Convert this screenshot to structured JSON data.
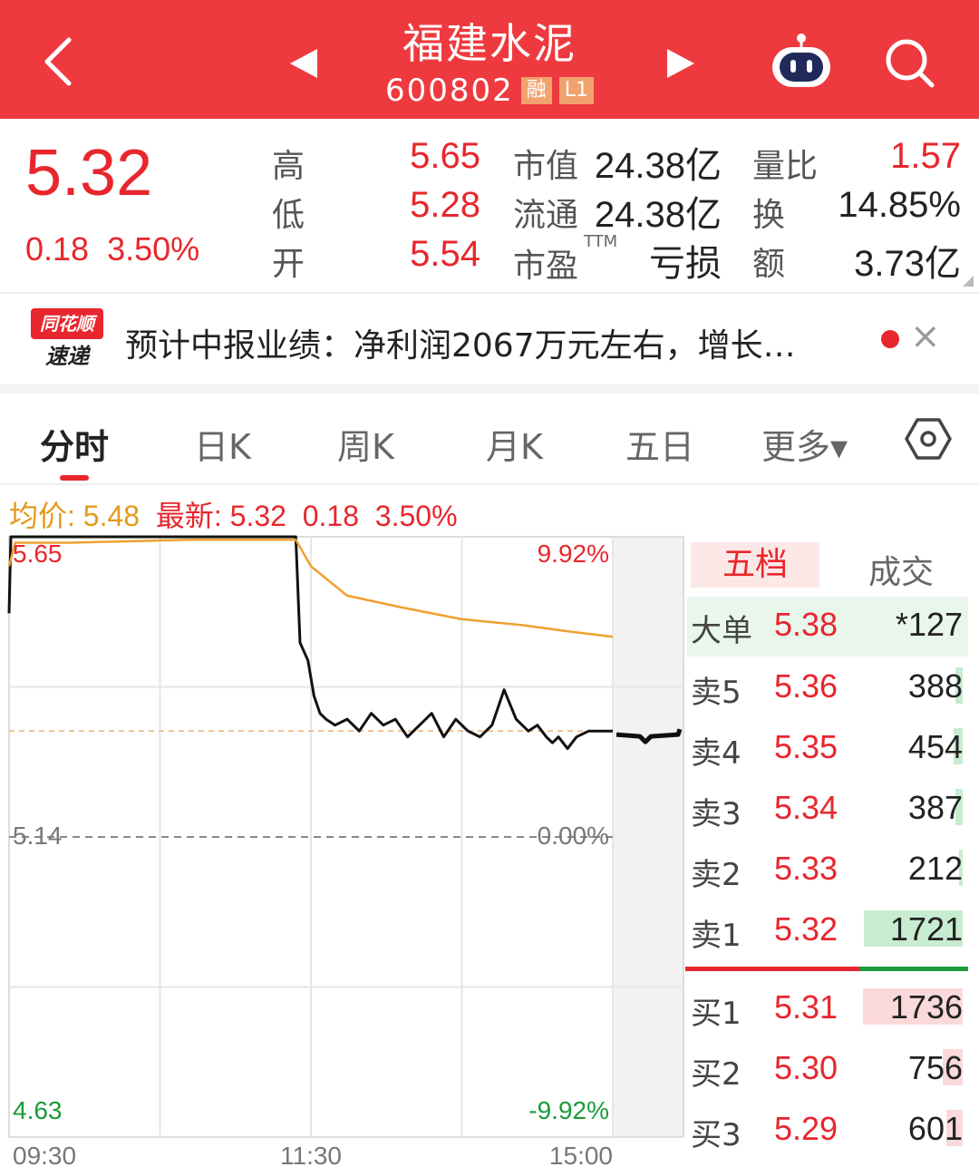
{
  "header": {
    "title": "福建水泥",
    "code": "600802",
    "tags": [
      "融",
      "L1"
    ],
    "icons": [
      "back-chevron-icon",
      "prev-stock-icon",
      "next-stock-icon",
      "robot-assistant-icon",
      "search-icon"
    ],
    "color": "#ee3a3f"
  },
  "quote": {
    "price": "5.32",
    "change": "0.18",
    "change_pct": "3.50%",
    "stats": [
      {
        "label": "高",
        "value": "5.65"
      },
      {
        "label": "低",
        "value": "5.28"
      },
      {
        "label": "开",
        "value": "5.54"
      },
      {
        "label": "市值",
        "value": "24.38亿"
      },
      {
        "label": "流通",
        "value": "24.38亿"
      },
      {
        "label": "市盈",
        "value": "亏损",
        "sup": "TTM"
      },
      {
        "label": "量比",
        "value": "1.57"
      },
      {
        "label": "换",
        "value": "14.85%"
      },
      {
        "label": "额",
        "value": "3.73亿"
      }
    ]
  },
  "news": {
    "logo_top": "同花顺",
    "logo_bottom": "速递",
    "text": "预计中报业绩：净利润2067万元左右，增长…",
    "close": "×"
  },
  "tabs": [
    "分时",
    "日K",
    "周K",
    "月K",
    "五日",
    "更多▾"
  ],
  "info": {
    "avg_label": "均价: 5.48",
    "latest_label": "最新: 5.32",
    "change": "0.18",
    "change_pct": "3.50%"
  },
  "chart_data": {
    "type": "line",
    "title": "",
    "x_ticks": [
      "09:30",
      "11:30",
      "15:00"
    ],
    "y_left_ticks": [
      "5.65",
      "5.14",
      "4.63"
    ],
    "y_right_ticks": [
      "9.92%",
      "0.00%",
      "-9.92%"
    ],
    "ylim": [
      4.63,
      5.65
    ],
    "prev_close": 5.14,
    "series": [
      {
        "name": "最新",
        "color": "#111111",
        "x": [
          0,
          0.003,
          0.01,
          0.2,
          0.4,
          0.475,
          0.482,
          0.495,
          0.505,
          0.515,
          0.525,
          0.54,
          0.56,
          0.58,
          0.6,
          0.62,
          0.64,
          0.66,
          0.68,
          0.7,
          0.72,
          0.74,
          0.76,
          0.78,
          0.8,
          0.82,
          0.84,
          0.86,
          0.875,
          0.89,
          0.9,
          0.91,
          0.925,
          0.94,
          0.96,
          0.98,
          1.0
        ],
        "y": [
          5.52,
          5.65,
          5.65,
          5.65,
          5.65,
          5.65,
          5.47,
          5.44,
          5.38,
          5.35,
          5.34,
          5.33,
          5.34,
          5.32,
          5.35,
          5.33,
          5.34,
          5.31,
          5.33,
          5.35,
          5.31,
          5.34,
          5.32,
          5.31,
          5.33,
          5.39,
          5.34,
          5.32,
          5.33,
          5.31,
          5.3,
          5.31,
          5.29,
          5.31,
          5.32,
          5.32,
          5.32
        ]
      },
      {
        "name": "均价",
        "color": "#f0a030",
        "x": [
          0,
          0.01,
          0.1,
          0.3,
          0.475,
          0.5,
          0.56,
          0.65,
          0.75,
          0.85,
          0.92,
          1.0
        ],
        "y": [
          5.6,
          5.64,
          5.64,
          5.645,
          5.645,
          5.6,
          5.55,
          5.53,
          5.51,
          5.5,
          5.49,
          5.48
        ]
      }
    ],
    "current_price_line": 5.32
  },
  "order_book": {
    "tabs": [
      "五档",
      "成交"
    ],
    "big_order": {
      "label": "大单",
      "price": "5.38",
      "vol": "*127"
    },
    "asks": [
      {
        "label": "卖5",
        "price": "5.36",
        "vol": "388",
        "bar": 0.07
      },
      {
        "label": "卖4",
        "price": "5.35",
        "vol": "454",
        "bar": 0.09
      },
      {
        "label": "卖3",
        "price": "5.34",
        "vol": "387",
        "bar": 0.07
      },
      {
        "label": "卖2",
        "price": "5.33",
        "vol": "212",
        "bar": 0.04
      },
      {
        "label": "卖1",
        "price": "5.32",
        "vol": "1721",
        "bar": 0.99
      }
    ],
    "bids": [
      {
        "label": "买1",
        "price": "5.31",
        "vol": "1736",
        "bar": 1.0
      },
      {
        "label": "买2",
        "price": "5.30",
        "vol": "756",
        "bar": 0.2
      },
      {
        "label": "买3",
        "price": "5.29",
        "vol": "601",
        "bar": 0.16
      }
    ],
    "colors": {
      "ask_bar": "#c8ecd0",
      "bid_bar": "#fbd9da"
    }
  }
}
